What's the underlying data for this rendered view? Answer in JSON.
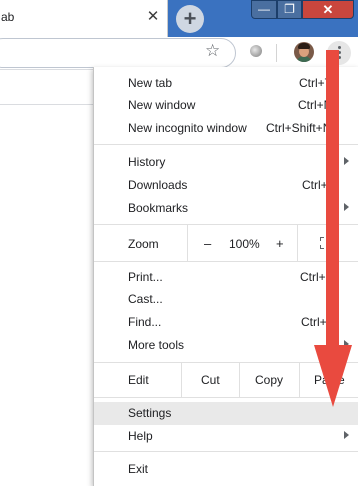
{
  "tab": {
    "title": "ab",
    "close_glyph": "✕"
  },
  "new_tab_glyph": "+",
  "window_controls": {
    "minimize": "—",
    "maximize": "❐",
    "close": "✕"
  },
  "toolbar": {
    "star_glyph": "☆"
  },
  "menu": {
    "new_tab": {
      "label": "New tab",
      "shortcut": "Ctrl+T"
    },
    "new_window": {
      "label": "New window",
      "shortcut": "Ctrl+N"
    },
    "new_incognito": {
      "label": "New incognito window",
      "shortcut": "Ctrl+Shift+N"
    },
    "history": {
      "label": "History"
    },
    "downloads": {
      "label": "Downloads",
      "shortcut": "Ctrl+J"
    },
    "bookmarks": {
      "label": "Bookmarks"
    },
    "zoom": {
      "label": "Zoom",
      "minus": "–",
      "value": "100%",
      "plus": "+"
    },
    "print": {
      "label": "Print...",
      "shortcut": "Ctrl+P"
    },
    "cast": {
      "label": "Cast..."
    },
    "find": {
      "label": "Find...",
      "shortcut": "Ctrl+F"
    },
    "more_tools": {
      "label": "More tools"
    },
    "edit": {
      "label": "Edit",
      "cut": "Cut",
      "copy": "Copy",
      "paste": "Paste"
    },
    "settings": {
      "label": "Settings"
    },
    "help": {
      "label": "Help"
    },
    "exit": {
      "label": "Exit"
    }
  },
  "colors": {
    "titlebar": "#3a72c0",
    "close_button": "#c9463d",
    "menu_highlight": "#e9e9e9",
    "annotation_arrow": "#e94a3f"
  },
  "icons": [
    "close-icon",
    "new-tab-icon",
    "star-icon",
    "extension-icon",
    "avatar",
    "kebab-menu-icon",
    "submenu-arrow-icon",
    "fullscreen-icon",
    "annotation-arrow"
  ]
}
